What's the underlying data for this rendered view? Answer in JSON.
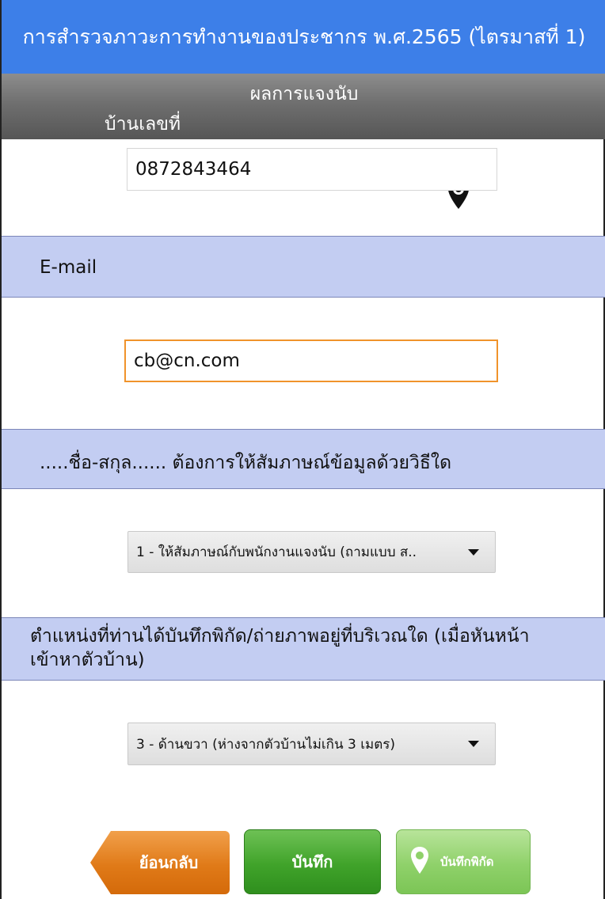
{
  "header": {
    "title": "การสำรวจภาวะการทำงานของประชากร พ.ศ.2565 (ไตรมาสที่ 1)",
    "subtitle": "ผลการแจงนับ",
    "house_label": "บ้านเลขที่",
    "location_icon": "map-pin-icon"
  },
  "phone": {
    "value": "0872843464"
  },
  "email": {
    "label": "E-mail",
    "value": "cb@cn.com"
  },
  "interview_method": {
    "label": ".....ชื่อ-สกุล...... ต้องการให้สัมภาษณ์ข้อมูลด้วยวิธีใด",
    "selected": "1 - ให้สัมภาษณ์กับพนักงานแจงนับ (ถามแบบ ส.."
  },
  "photo_position": {
    "label_line1": "ตำแหน่งที่ท่านได้บันทึกพิกัด/ถ่ายภาพอยู่ที่บริเวณใด (เมื่อหันหน้า",
    "label_line2": "เข้าหาตัวบ้าน)",
    "selected": "3 - ด้านขวา (ห่างจากตัวบ้านไม่เกิน 3 เมตร)"
  },
  "buttons": {
    "back": "ย้อนกลับ",
    "save": "บันทึก",
    "save_location": "บันทึกพิกัด"
  },
  "colors": {
    "title_bar": "#3d7fe8",
    "section_bg": "#c3cdf2",
    "focus_border": "#f0932b",
    "back_button": "#e07a18",
    "save_button": "#40a32a",
    "location_button": "#8fd16a"
  }
}
